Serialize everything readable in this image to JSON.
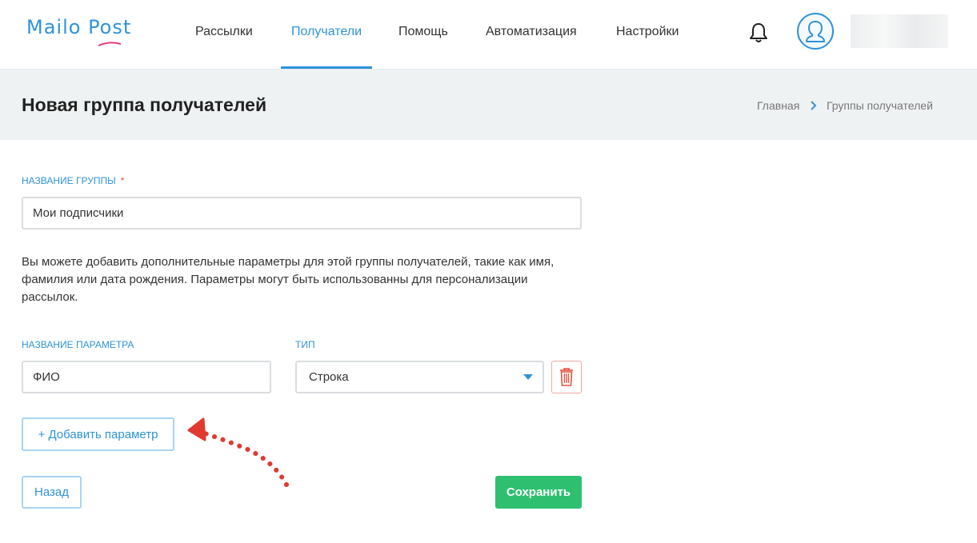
{
  "header": {
    "logo": "Mailo Post",
    "nav": [
      {
        "label": "Рассылки",
        "active": false
      },
      {
        "label": "Получатели",
        "active": true
      },
      {
        "label": "Помощь",
        "active": false
      },
      {
        "label": "Автоматизация",
        "active": false
      },
      {
        "label": "Настройки",
        "active": false
      }
    ],
    "icons": {
      "notifications": "bell-icon",
      "profile": "user-avatar-icon"
    }
  },
  "page": {
    "title": "Новая группа получателей",
    "breadcrumb": [
      "Главная",
      "Группы получателей"
    ]
  },
  "form": {
    "group_name_label": "НАЗВАНИЕ ГРУППЫ",
    "required_mark": "*",
    "group_name_value": "Мои подписчики",
    "hint": "Вы можете добавить дополнительные параметры для этой группы получателей, такие как имя, фамилия или дата рождения. Параметры могут быть использованны для персонализации рассылок.",
    "param_name_label": "НАЗВАНИЕ ПАРАМЕТРА",
    "type_label": "ТИП",
    "param_name_value": "ФИО",
    "type_value": "Строка",
    "add_param_label": "+ Добавить параметр",
    "back_label": "Назад",
    "save_label": "Сохранить"
  },
  "colors": {
    "accent": "#2f93d8",
    "success": "#2ec070",
    "danger": "#e5533b",
    "title_bar_bg": "#eff2f3"
  }
}
